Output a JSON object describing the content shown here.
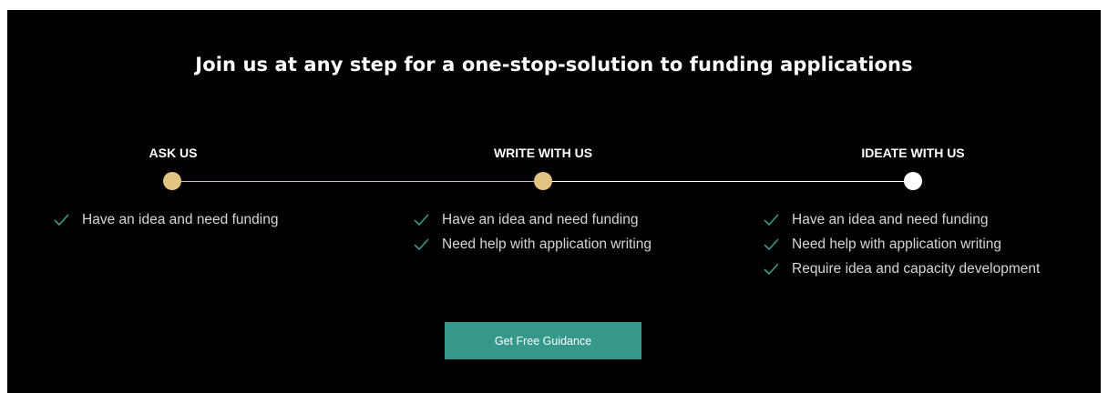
{
  "headline": "Join us at any step for a one-stop-solution to funding applications",
  "colors": {
    "background": "#000000",
    "accent_gold": "#e3c483",
    "check_green": "#3d9a88",
    "button_teal": "#35988a",
    "white": "#ffffff"
  },
  "steps": [
    {
      "title": "ASK US",
      "dot_color": "#e3c483",
      "items": [
        "Have an idea and need funding"
      ]
    },
    {
      "title": "WRITE WITH US",
      "dot_color": "#e3c483",
      "items": [
        "Have an idea and need funding",
        "Need help with application writing"
      ]
    },
    {
      "title": "IDEATE WITH US",
      "dot_color": "#ffffff",
      "items": [
        "Have an idea and need funding",
        "Need help with application writing",
        "Require idea and capacity development"
      ]
    }
  ],
  "cta": {
    "label": "Get Free Guidance"
  }
}
